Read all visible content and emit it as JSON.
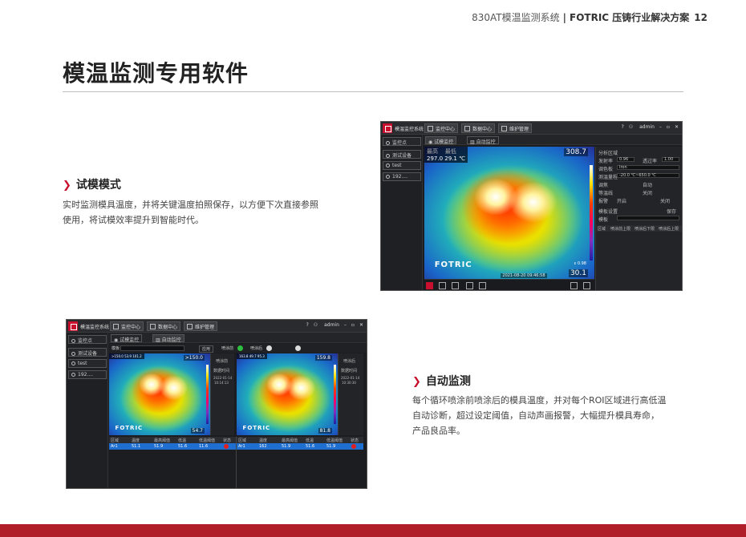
{
  "header": {
    "product": "830AT模温监测系统",
    "brand": "FOTRIC 压铸行业解决方案",
    "page_number": "12"
  },
  "page_title": "模温监测专用软件",
  "sections": [
    {
      "title": "试模模式",
      "body_lines": [
        "实时监测模具温度，并将关键温度拍照保存，以方便下次直接参照",
        "使用，将试模效率提升到智能时代。"
      ]
    },
    {
      "title": "自动监测",
      "body_lines": [
        "每个循环喷涂前喷涂后的模具温度，并对每个ROI区域进行高低温",
        "自动诊断，超过设定阈值，自动声画报警，大幅提升模具寿命，",
        "产品良品率。"
      ]
    }
  ],
  "window1": {
    "app_name": "模温监控系统",
    "tabs": [
      "监控中心",
      "数据中心",
      "维护管理"
    ],
    "user": "admin",
    "sub_tabs": [
      "试模监控",
      "自动监控"
    ],
    "sidebar": [
      "监控点",
      "测试设备",
      "test",
      "192...."
    ],
    "readout": {
      "max_label": "最高",
      "min_label": "最低",
      "max": "297.0",
      "min": "29.1",
      "unit": "℃"
    },
    "scale_max": "308.7",
    "scale_min": "30.1",
    "emissivity": "ε 0.98",
    "brand_mark": "FOTRIC",
    "timestamp": "2021-08-20 09:46:58",
    "panel": {
      "analysis_title": "分析区域",
      "emissivity_label": "发射率",
      "emissivity_value": "0.96",
      "transmit_label": "透过率",
      "transmit_value": "1.00",
      "palette_label": "调色板",
      "palette_value": "Iron",
      "range_label": "测温量程",
      "range_value": "-20.0 ℃~650.0 ℃",
      "focus_label": "调焦",
      "focus_value": "自动",
      "isotherm_label": "等温线",
      "isotherm_value": "关闭",
      "alarm_label": "报警",
      "alarm_on": "开启",
      "alarm_off": "关闭",
      "template_title": "模板设置",
      "template_name": "模板",
      "save_label": "保存",
      "cols": [
        "区域",
        "喷涂前上限",
        "喷涂后下限",
        "喷涂后上限"
      ]
    }
  },
  "window2": {
    "app_name": "模温监控系统",
    "tabs": [
      "监控中心",
      "数据中心",
      "维护管理"
    ],
    "user": "admin",
    "sub_tabs": [
      "试模监控",
      "自动监控"
    ],
    "sidebar": [
      "监控点",
      "测试设备",
      "test",
      "192...."
    ],
    "filter_label": "模板",
    "apply_label": "应用",
    "before_label": "喷涂前",
    "after_label": "喷涂后",
    "cam1": {
      "readout": ">150.0 53.9 101.2",
      "scale_max": ">150.0",
      "scale_min": "54.7",
      "side_title": "喷涂前",
      "side_sub": "数据时间",
      "date": "2022-01-14",
      "time": "10:14:13"
    },
    "cam2": {
      "readout": "163.8 49.7 95.3",
      "scale_max": "159.8",
      "scale_min": "81.8",
      "side_title": "喷涂后",
      "side_sub": "数据时间",
      "date": "2022-01-14",
      "time": "10:30:30"
    },
    "brand_mark": "FOTRIC",
    "table_cols": [
      "区域",
      "温度",
      "最高阈值",
      "低温",
      "低温阈值",
      "状态"
    ],
    "table_row1": [
      "Ar1",
      "51.1",
      "51.9",
      "51.6",
      "11.6"
    ],
    "table_row2": [
      "Ar1",
      "162",
      "51.9",
      "51.6",
      "51.9"
    ]
  }
}
